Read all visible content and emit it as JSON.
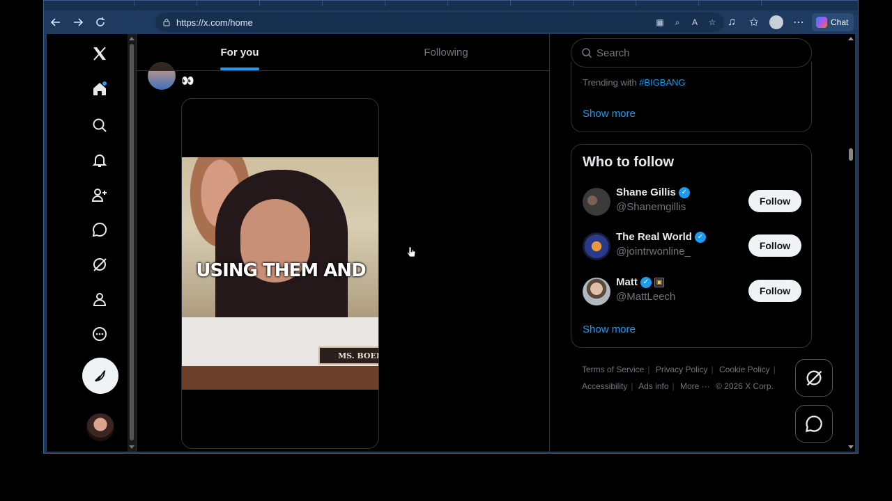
{
  "browser": {
    "url": "https://x.com/home",
    "chat_label": "Chat"
  },
  "nav": {
    "items": [
      "x-logo",
      "home-icon",
      "search-icon",
      "bell-icon",
      "add-user-icon",
      "message-icon",
      "grok-icon",
      "profile-icon",
      "more-icon"
    ],
    "post_icon": "compose-icon"
  },
  "feed": {
    "tabs": [
      {
        "label": "For you",
        "active": true
      },
      {
        "label": "Following",
        "active": false
      }
    ],
    "post": {
      "emoji_text": "👀",
      "video_caption": "USING THEM AND",
      "nameplate": "MS. BOEBI"
    }
  },
  "right": {
    "search_placeholder": "Search",
    "trend": {
      "prefix": "Trending with",
      "tag": "#BIGBANG",
      "show_more": "Show more"
    },
    "who_to_follow": {
      "title": "Who to follow",
      "users": [
        {
          "name": "Shane Gillis",
          "handle": "@Shanemgillis",
          "button": "Follow"
        },
        {
          "name": "The Real World",
          "handle": "@jointrwonline_",
          "button": "Follow"
        },
        {
          "name": "Matt",
          "handle": "@MattLeech",
          "button": "Follow"
        }
      ],
      "show_more": "Show more"
    },
    "footer": {
      "links": [
        "Terms of Service",
        "Privacy Policy",
        "Cookie Policy",
        "Accessibility",
        "Ads info",
        "More ···",
        "© 2026 X Corp."
      ]
    }
  }
}
